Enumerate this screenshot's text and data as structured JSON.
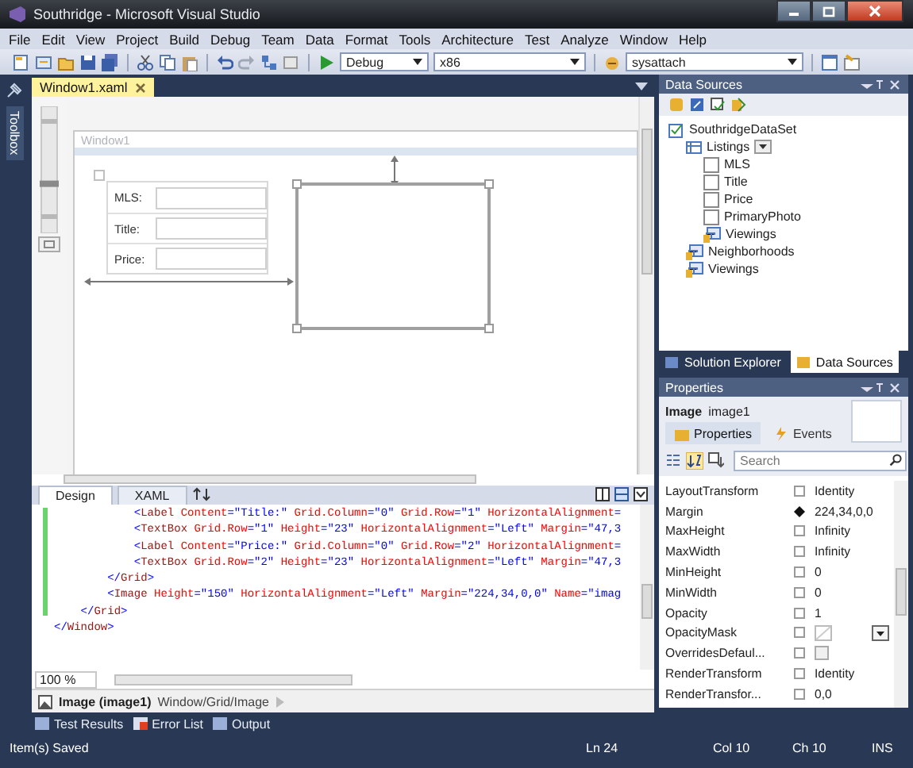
{
  "window": {
    "title": "Southridge - Microsoft Visual Studio"
  },
  "menu": [
    "File",
    "Edit",
    "View",
    "Project",
    "Build",
    "Debug",
    "Team",
    "Data",
    "Format",
    "Tools",
    "Architecture",
    "Test",
    "Analyze",
    "Window",
    "Help"
  ],
  "toolbar": {
    "configuration": "Debug",
    "platform": "x86",
    "process": "sysattach"
  },
  "toolbox_tab": "Toolbox",
  "document_tabs": [
    {
      "label": "Window1.xaml",
      "selected": true
    }
  ],
  "zoom_slider": {
    "level": 0.4
  },
  "designer": {
    "window_title": "Window1",
    "form_labels": [
      "MLS:",
      "Title:",
      "Price:"
    ]
  },
  "view_tabs": [
    {
      "label": "Design",
      "selected": true
    },
    {
      "label": "XAML",
      "selected": false
    }
  ],
  "code_lines": [
    [
      {
        "kind": "punct",
        "text": "            <"
      },
      {
        "kind": "tag",
        "text": "Label"
      },
      {
        "kind": "attr",
        "text": " Content"
      },
      {
        "kind": "val",
        "text": "=\"Title:\""
      },
      {
        "kind": "attr",
        "text": " Grid.Column"
      },
      {
        "kind": "val",
        "text": "=\"0\""
      },
      {
        "kind": "attr",
        "text": " Grid.Row"
      },
      {
        "kind": "val",
        "text": "=\"1\""
      },
      {
        "kind": "attr",
        "text": " HorizontalAlignment"
      },
      {
        "kind": "val",
        "text": "="
      }
    ],
    [
      {
        "kind": "punct",
        "text": "            <"
      },
      {
        "kind": "tag",
        "text": "TextBox"
      },
      {
        "kind": "attr",
        "text": " Grid.Row"
      },
      {
        "kind": "val",
        "text": "=\"1\""
      },
      {
        "kind": "attr",
        "text": " Height"
      },
      {
        "kind": "val",
        "text": "=\"23\""
      },
      {
        "kind": "attr",
        "text": " HorizontalAlignment"
      },
      {
        "kind": "val",
        "text": "=\"Left\""
      },
      {
        "kind": "attr",
        "text": " Margin"
      },
      {
        "kind": "val",
        "text": "=\"47,3"
      }
    ],
    [
      {
        "kind": "punct",
        "text": "            <"
      },
      {
        "kind": "tag",
        "text": "Label"
      },
      {
        "kind": "attr",
        "text": " Content"
      },
      {
        "kind": "val",
        "text": "=\"Price:\""
      },
      {
        "kind": "attr",
        "text": " Grid.Column"
      },
      {
        "kind": "val",
        "text": "=\"0\""
      },
      {
        "kind": "attr",
        "text": " Grid.Row"
      },
      {
        "kind": "val",
        "text": "=\"2\""
      },
      {
        "kind": "attr",
        "text": " HorizontalAlignment"
      },
      {
        "kind": "val",
        "text": "="
      }
    ],
    [
      {
        "kind": "punct",
        "text": "            <"
      },
      {
        "kind": "tag",
        "text": "TextBox"
      },
      {
        "kind": "attr",
        "text": " Grid.Row"
      },
      {
        "kind": "val",
        "text": "=\"2\""
      },
      {
        "kind": "attr",
        "text": " Height"
      },
      {
        "kind": "val",
        "text": "=\"23\""
      },
      {
        "kind": "attr",
        "text": " HorizontalAlignment"
      },
      {
        "kind": "val",
        "text": "=\"Left\""
      },
      {
        "kind": "attr",
        "text": " Margin"
      },
      {
        "kind": "val",
        "text": "=\"47,3"
      }
    ],
    [
      {
        "kind": "punct",
        "text": "        </"
      },
      {
        "kind": "tag",
        "text": "Grid"
      },
      {
        "kind": "punct",
        "text": ">"
      }
    ],
    [
      {
        "kind": "punct",
        "text": "        <"
      },
      {
        "kind": "tag",
        "text": "Image"
      },
      {
        "kind": "attr",
        "text": " Height"
      },
      {
        "kind": "val",
        "text": "=\"150\""
      },
      {
        "kind": "attr",
        "text": " HorizontalAlignment"
      },
      {
        "kind": "val",
        "text": "=\"Left\""
      },
      {
        "kind": "attr",
        "text": " Margin"
      },
      {
        "kind": "val",
        "text": "=\"224,34,0,0\""
      },
      {
        "kind": "attr",
        "text": " Name"
      },
      {
        "kind": "val",
        "text": "=\"imag"
      }
    ],
    [
      {
        "kind": "punct",
        "text": "    </"
      },
      {
        "kind": "tag",
        "text": "Grid"
      },
      {
        "kind": "punct",
        "text": ">"
      }
    ],
    [
      {
        "kind": "punct",
        "text": "</"
      },
      {
        "kind": "tag",
        "text": "Window"
      },
      {
        "kind": "punct",
        "text": ">"
      }
    ]
  ],
  "zoom": "100 %",
  "breadcrumb": {
    "element": "Image (image1)",
    "path": "Window/Grid/Image"
  },
  "data_sources": {
    "title": "Data Sources",
    "tree": [
      {
        "label": "SouthridgeDataSet",
        "kind": "dataset",
        "children": [
          {
            "label": "Listings",
            "kind": "table",
            "children": [
              {
                "label": "MLS",
                "kind": "field"
              },
              {
                "label": "Title",
                "kind": "field"
              },
              {
                "label": "Price",
                "kind": "field"
              },
              {
                "label": "PrimaryPhoto",
                "kind": "field"
              },
              {
                "label": "Viewings",
                "kind": "relation"
              }
            ]
          },
          {
            "label": "Neighborhoods",
            "kind": "relation"
          },
          {
            "label": "Viewings",
            "kind": "relation"
          }
        ]
      }
    ]
  },
  "right_tabs": [
    {
      "label": "Solution Explorer",
      "selected": false
    },
    {
      "label": "Data Sources",
      "selected": true
    }
  ],
  "properties": {
    "title": "Properties",
    "type": "Image",
    "name": "image1",
    "tabs": [
      {
        "label": "Properties",
        "selected": true
      },
      {
        "label": "Events",
        "selected": false
      }
    ],
    "search": {
      "placeholder": "Search"
    },
    "rows": [
      {
        "name": "LayoutTransform",
        "set": false,
        "kind": "text",
        "value": "Identity"
      },
      {
        "name": "Margin",
        "set": true,
        "kind": "text",
        "value": "224,34,0,0"
      },
      {
        "name": "MaxHeight",
        "set": false,
        "kind": "text",
        "value": "Infinity"
      },
      {
        "name": "MaxWidth",
        "set": false,
        "kind": "text",
        "value": "Infinity"
      },
      {
        "name": "MinHeight",
        "set": false,
        "kind": "text",
        "value": "0"
      },
      {
        "name": "MinWidth",
        "set": false,
        "kind": "text",
        "value": "0"
      },
      {
        "name": "Opacity",
        "set": false,
        "kind": "text",
        "value": "1"
      },
      {
        "name": "OpacityMask",
        "set": false,
        "kind": "brush"
      },
      {
        "name": "OverridesDefaul...",
        "set": false,
        "kind": "checkbox",
        "checked": false
      },
      {
        "name": "RenderTransform",
        "set": false,
        "kind": "text",
        "value": "Identity"
      },
      {
        "name": "RenderTransfor...",
        "set": false,
        "kind": "text",
        "value": "0,0"
      }
    ]
  },
  "bottom_tabs": [
    "Test Results",
    "Error List",
    "Output"
  ],
  "status_bar": {
    "message": "Item(s) Saved",
    "line": "Ln 24",
    "column": "Col 10",
    "char": "Ch 10",
    "mode": "INS"
  }
}
